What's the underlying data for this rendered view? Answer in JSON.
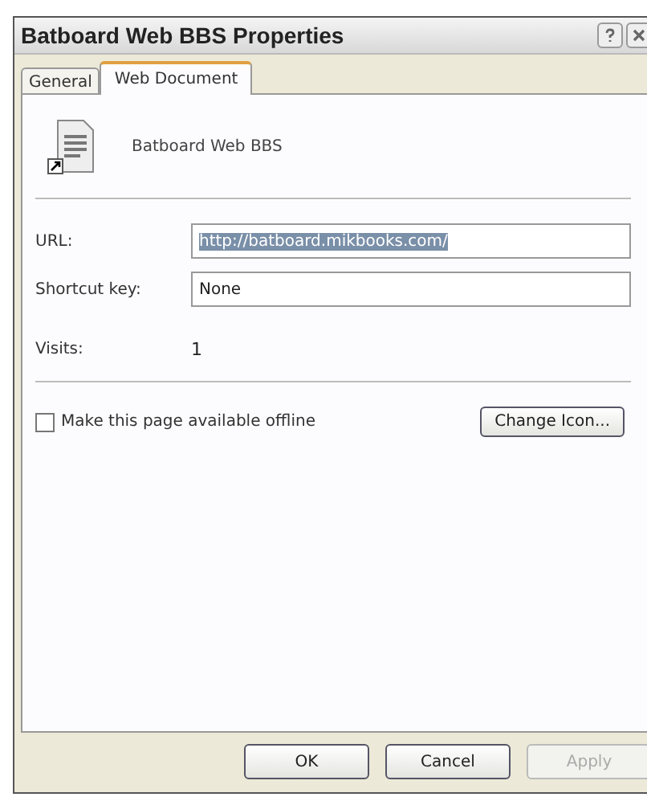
{
  "window": {
    "title": "Batboard Web BBS Properties"
  },
  "tabs": [
    {
      "label": "General",
      "selected": false
    },
    {
      "label": "Web Document",
      "selected": true
    }
  ],
  "document": {
    "name": "Batboard Web BBS"
  },
  "fields": [
    {
      "label": "URL:",
      "value": "http://batboard.mikbooks.com/",
      "text_selected": true
    },
    {
      "label": "Shortcut key:",
      "value": "None",
      "text_selected": false
    }
  ],
  "visits": {
    "label": "Visits:",
    "value": "1"
  },
  "offline": {
    "label": "Make this page available offline",
    "checked": false
  },
  "change_icon_button": "Change Icon...",
  "buttons": [
    {
      "label": "OK",
      "disabled": false
    },
    {
      "label": "Cancel",
      "disabled": false
    },
    {
      "label": "Apply",
      "disabled": true
    }
  ]
}
